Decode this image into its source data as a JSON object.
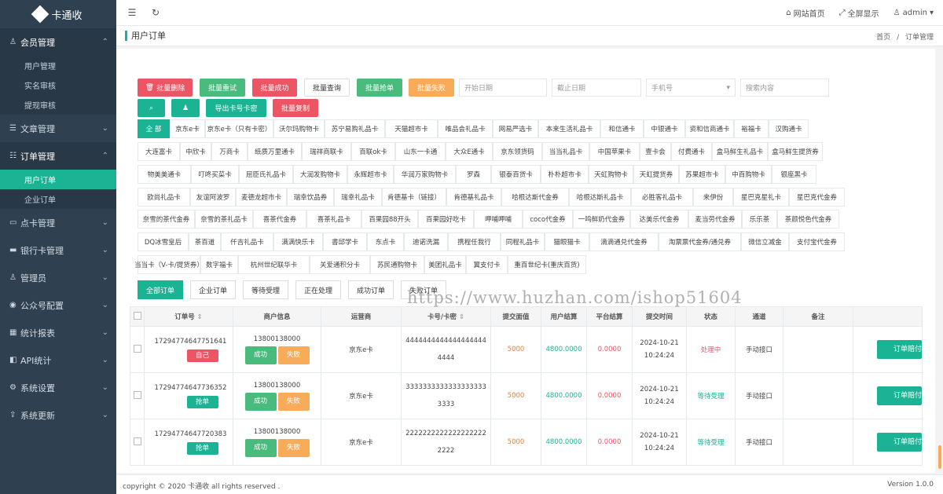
{
  "brand": {
    "name": "卡通收"
  },
  "sidebar": [
    {
      "label": "会员管理",
      "open": true,
      "items": [
        "用户管理",
        "实名审核",
        "提现审核"
      ]
    },
    {
      "label": "文章管理"
    },
    {
      "label": "订单管理",
      "open": true,
      "items": [
        "用户订单",
        "企业订单"
      ],
      "active": "用户订单"
    },
    {
      "label": "点卡管理"
    },
    {
      "label": "银行卡管理"
    },
    {
      "label": "管理员"
    },
    {
      "label": "公众号配置"
    },
    {
      "label": "统计报表"
    },
    {
      "label": "API统计"
    },
    {
      "label": "系统设置"
    },
    {
      "label": "系统更新"
    }
  ],
  "topbar": {
    "home": "网站首页",
    "fullscreen": "全屏显示",
    "user": "admin"
  },
  "page": {
    "title": "用户订单",
    "crumb_home": "首页",
    "crumb_sep": "/",
    "crumb_current": "订单管理"
  },
  "toolbar": {
    "batch_delete": "批量删除",
    "batch_retry": "批量重试",
    "batch_success": "批量成功",
    "batch_query": "批量查询",
    "batch_grab": "批量抢单",
    "batch_fail": "批量失败",
    "start_date": "开始日期",
    "end_date": "截止日期",
    "phone_select": "手机号",
    "search_placeholder": "搜索内容",
    "export": "导出卡号卡密",
    "batch_copy": "批量复制"
  },
  "cards": [
    [
      "全 部",
      "京东e卡",
      "京东e卡（只有卡密）",
      "沃尔玛购物卡",
      "苏宁易购礼品卡",
      "天猫超市卡",
      "唯品会礼品卡",
      "网易严选卡",
      "本来生活礼品卡",
      "和信通卡",
      "中银通卡",
      "资和信商通卡",
      "裕福卡",
      "汉购通卡"
    ],
    [
      "大连富卡",
      "中欣卡",
      "万商卡",
      "纸质万里通卡",
      "瑞祥商联卡",
      "百联ok卡",
      "山东一卡通",
      "大众E通卡",
      "京东领货码",
      "当当礼品卡",
      "中国苹果卡",
      "壹卡会",
      "付费通卡",
      "盒马鲜生礼品卡",
      "盒马鲜生提货券"
    ],
    [
      "物美美通卡",
      "叮咚买菜卡",
      "屈臣氏礼品卡",
      "大润发购物卡",
      "永辉超市卡",
      "华润万家购物卡",
      "罗森",
      "银泰百货卡",
      "朴朴超市卡",
      "天虹购物卡",
      "天虹提货券",
      "苏果超市卡",
      "中百购物卡",
      "银座黑卡"
    ],
    [
      "欧尚礼品卡",
      "友谊阿波罗",
      "麦德龙超市卡",
      "瑞幸饮品券",
      "瑞幸礼品卡",
      "肯德基卡（链接）",
      "肯德基礼品卡",
      "哈根达斯代金券",
      "哈根达斯礼品卡",
      "必胜客礼品卡",
      "来伊份",
      "星巴克星礼卡",
      "星巴克代金券"
    ],
    [
      "奈雪的茶代金券",
      "奈雪的茶礼品卡",
      "喜茶代金券",
      "喜茶礼品卡",
      "百果园88开头",
      "百果园好吃卡",
      "呷哺呷哺",
      "coco代金券",
      "一鸣鲜奶代金券",
      "达美乐代金券",
      "麦当劳代金券",
      "乐乐茶",
      "茶颜悦色代金券"
    ],
    [
      "DQ冰雪皇后",
      "茶百道",
      "仟吉礼品卡",
      "满满快乐卡",
      "書邱学卡",
      "东点卡",
      "迪诺洗漏",
      "携程任我行",
      "同程礼品卡",
      "猫眼猫卡",
      "滴滴通兑代金券",
      "淘票票代金券/通兑券",
      "微信立减金",
      "支付宝代金券"
    ],
    [
      "当当卡（V-卡/提货券）",
      "数字福卡",
      "杭州世纪联华卡",
      "关爱通积分卡",
      "苏民通购物卡",
      "美团礼品卡",
      "翼支付卡",
      "重百世纪卡(重庆百货)"
    ]
  ],
  "filters": [
    "全部订单",
    "企业订单",
    "等待受理",
    "正在处理",
    "成功订单",
    "失败订单"
  ],
  "table": {
    "headers": [
      "订单号",
      "商户信息",
      "运营商",
      "卡号/卡密",
      "提交面值",
      "用户结算",
      "平台结算",
      "提交时间",
      "状态",
      "通道",
      "备注",
      ""
    ],
    "rows": [
      {
        "order": "17294774647751641",
        "tag": "自己",
        "tag_color": "#ed5565",
        "merchant": "13800138000",
        "ok": "成功",
        "fail": "失败",
        "carrier": "京东e卡",
        "card": "4444444444444444444",
        "card2": "4444",
        "amount": "5000",
        "user": "4800.0000",
        "platform": "0.0000",
        "date": "2024-10-21",
        "time": "10:24:24",
        "status": "处理中",
        "status_color": "#ed5565",
        "channel": "手动接口",
        "action": "订单赔付"
      },
      {
        "order": "17294774647736352",
        "tag": "抢单",
        "tag_color": "#1ab394",
        "merchant": "13800138000",
        "ok": "成功",
        "fail": "失败",
        "carrier": "京东e卡",
        "card": "3333333333333333333",
        "card2": "3333",
        "amount": "5000",
        "user": "4800.0000",
        "platform": "0.0000",
        "date": "2024-10-21",
        "time": "10:24:24",
        "status": "等待受理",
        "status_color": "#1ab394",
        "channel": "手动接口",
        "action": "订单赔付"
      },
      {
        "order": "17294774647720383",
        "tag": "抢单",
        "tag_color": "#1ab394",
        "merchant": "13800138000",
        "ok": "成功",
        "fail": "失败",
        "carrier": "京东e卡",
        "card": "2222222222222222222",
        "card2": "2222",
        "amount": "5000",
        "user": "4800.0000",
        "platform": "0.0000",
        "date": "2024-10-21",
        "time": "10:24:24",
        "status": "等待受理",
        "status_color": "#1ab394",
        "channel": "手动接口",
        "action": "订单赔付"
      }
    ]
  },
  "watermark": "https://www.huzhan.com/ishop51604",
  "footer": {
    "copyright": "copyright © 2020 卡通收 all rights reserved .",
    "version": "Version 1.0.0"
  },
  "colors": {
    "sidebar": "#2f4050",
    "accent": "#1ab394",
    "red": "#ed5565",
    "orange": "#f8ac59",
    "green": "#49bb7d"
  }
}
